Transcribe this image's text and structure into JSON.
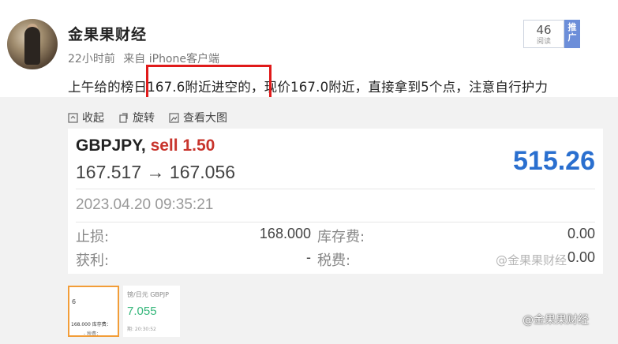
{
  "post": {
    "username": "金果果财经",
    "time": "22小时前",
    "source": "来自 iPhone客户端",
    "views": {
      "count": "46",
      "label": "阅读"
    },
    "promote_label": "推广",
    "text": "上午给的榜日167.6附近进空的，现价167.0附近，直接拿到5个点，注意自行护力"
  },
  "toolbar": {
    "collapse": "收起",
    "rotate": "旋转",
    "view_large": "查看大图"
  },
  "trade_card": {
    "pair": "GBPJPY,",
    "action": "sell 1.50",
    "price_path": "167.517 → 167.056",
    "profit": "515.26",
    "timestamp": "2023.04.20 09:35:21",
    "stop_loss_label": "止损:",
    "stop_loss_value": "168.000",
    "swap_label": "库存费:",
    "swap_value": "0.00",
    "take_profit_label": "获利:",
    "take_profit_value": "-",
    "tax_label": "税费:",
    "tax_value": "0.00"
  },
  "watermark": "@金果果财经",
  "thumbnails": {
    "first": {
      "a": "6",
      "b": "168.000  库存费：",
      "c": "-   税费："
    },
    "second": {
      "a": "镑/日元  GBPJP",
      "b": "7.055",
      "c": "期: 20:30:52"
    }
  },
  "bottom_watermark": "@金果果财经",
  "colors": {
    "sell": "#c8342c",
    "profit": "#2a6fcf",
    "highlight": "#e01a1a",
    "promote": "#6c8ed9",
    "thumb_border": "#f29d38"
  }
}
